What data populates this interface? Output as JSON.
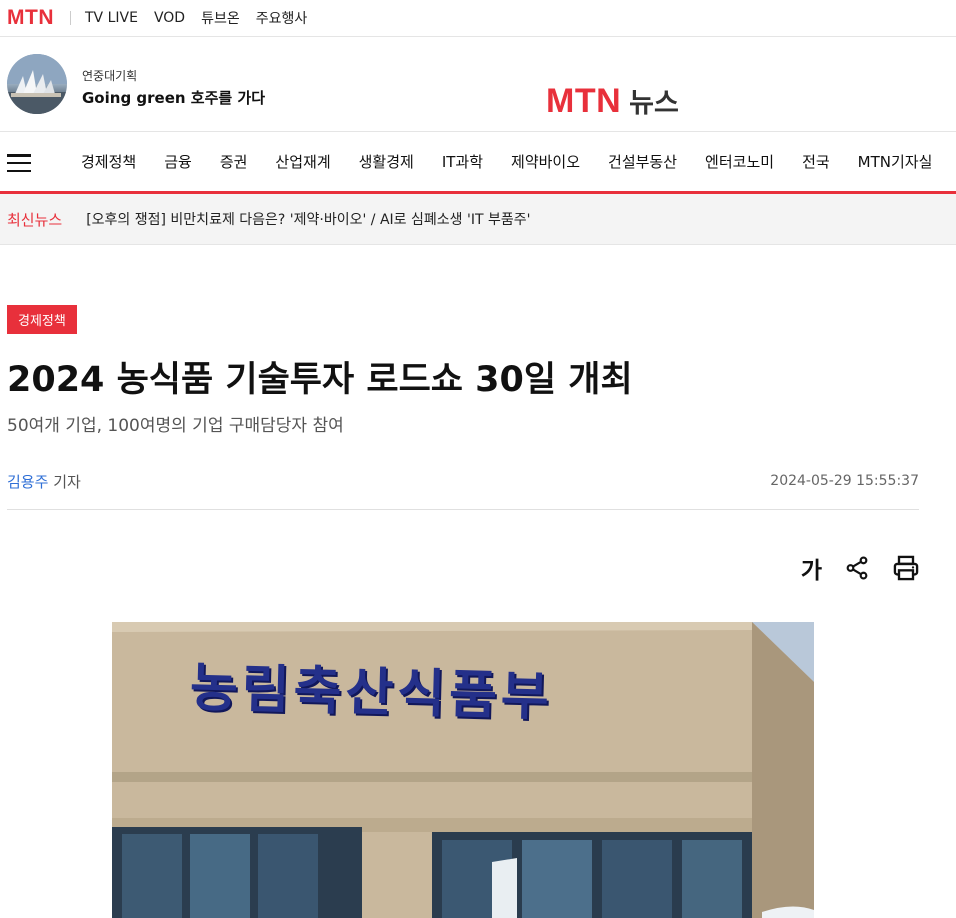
{
  "topbar": {
    "brand": "MTN",
    "links": [
      "TV LIVE",
      "VOD",
      "튜브온",
      "주요행사"
    ]
  },
  "header": {
    "promo_eyebrow": "연중대기획",
    "promo_title": "Going green 호주를 가다",
    "logo_mtn": "MTN",
    "logo_news": "뉴스"
  },
  "nav": {
    "items": [
      "경제정책",
      "금융",
      "증권",
      "산업재계",
      "생활경제",
      "IT과학",
      "제약바이오",
      "건설부동산",
      "엔터코노미",
      "전국",
      "MTN기자실"
    ]
  },
  "breaking": {
    "label": "최신뉴스",
    "headline": "[오후의 쟁점] 비만치료제 다음은? '제약·바이오' / AI로 심폐소생 'IT 부품주'"
  },
  "article": {
    "category": "경제정책",
    "title": "2024 농식품 기술투자 로드쇼 30일 개최",
    "subtitle": "50여개 기업, 100여명의 기업 구매담당자 참여",
    "reporter_name": "김용주",
    "reporter_suffix": "기자",
    "datetime": "2024-05-29 15:55:37",
    "font_tool_label": "가"
  },
  "photo": {
    "sign_text": "농림축산식품부"
  },
  "colors": {
    "accent": "#e8303b",
    "link": "#2f6fd6"
  },
  "icons": {
    "share": "share-icon",
    "print": "print-icon",
    "menu": "hamburger-menu-icon"
  }
}
